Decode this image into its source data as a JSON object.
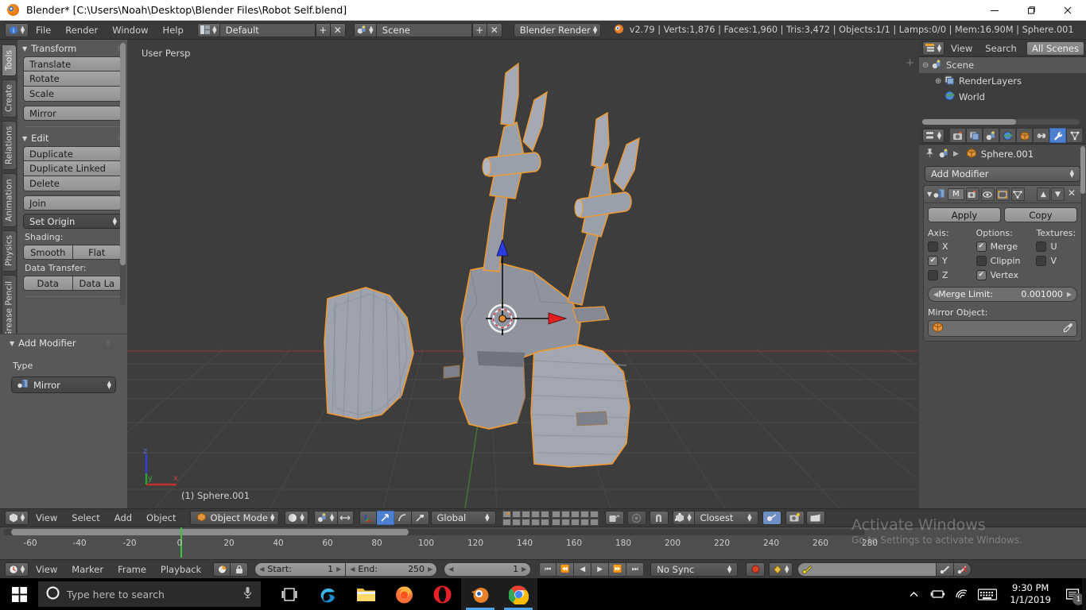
{
  "window": {
    "title": "Blender* [C:\\Users\\Noah\\Desktop\\Blender Files\\Robot Self.blend]",
    "minimize": "—",
    "maximize": "❐",
    "close": "✕"
  },
  "header": {
    "menus": [
      "File",
      "Render",
      "Window",
      "Help"
    ],
    "screen_layout": "Default",
    "scene": "Scene",
    "render_engine": "Blender Render",
    "stats": "v2.79 | Verts:1,876 | Faces:1,960 | Tris:3,472 | Objects:1/1 | Lamps:0/0 | Mem:16.90M | Sphere.001",
    "add_label": "+",
    "remove_label": "✕"
  },
  "toolshelf": {
    "tabs": [
      "Tools",
      "Create",
      "Relations",
      "Animation",
      "Physics",
      "Grease Pencil"
    ],
    "active_tab": "Tools",
    "transform": {
      "title": "Transform",
      "buttons": [
        "Translate",
        "Rotate",
        "Scale"
      ],
      "mirror": "Mirror"
    },
    "edit": {
      "title": "Edit",
      "buttons": [
        "Duplicate",
        "Duplicate Linked",
        "Delete"
      ],
      "join": "Join",
      "set_origin": "Set Origin",
      "shading_label": "Shading:",
      "shading_buttons": [
        "Smooth",
        "Flat"
      ],
      "data_transfer_label": "Data Transfer:",
      "data_buttons": [
        "Data",
        "Data La"
      ]
    },
    "add_modifier_panel": {
      "title": "Add Modifier",
      "type_label": "Type",
      "type_value": "Mirror"
    }
  },
  "viewport": {
    "view_label": "User Persp",
    "object_label": "(1) Sphere.001",
    "axis_x": "x",
    "axis_y": "y",
    "axis_z": "z"
  },
  "outliner": {
    "menus": [
      "View",
      "Search"
    ],
    "filter": "All Scenes",
    "rows": [
      {
        "label": "Scene",
        "icon": "scene-icon",
        "indent": 0,
        "selected": true
      },
      {
        "label": "RenderLayers",
        "icon": "renderlayers-icon",
        "indent": 1,
        "selected": false
      },
      {
        "label": "World",
        "icon": "world-icon",
        "indent": 1,
        "selected": false
      }
    ]
  },
  "properties": {
    "tabs": [
      "render-icon",
      "renderlayers-icon",
      "scene-icon",
      "world-icon",
      "object-icon",
      "constraints-icon",
      "modifiers-icon",
      "data-icon"
    ],
    "active_tab_index": 6,
    "breadcrumb_object": "Sphere.001",
    "add_modifier": "Add Modifier",
    "modifier": {
      "name_short": "M",
      "apply": "Apply",
      "copy": "Copy",
      "axis_title": "Axis:",
      "options_title": "Options:",
      "textures_title": "Textures:",
      "axis": [
        {
          "label": "X",
          "checked": false
        },
        {
          "label": "Y",
          "checked": true
        },
        {
          "label": "Z",
          "checked": false
        }
      ],
      "options": [
        {
          "label": "Merge",
          "checked": true
        },
        {
          "label": "Clippin",
          "checked": false
        },
        {
          "label": "Vertex",
          "checked": true
        }
      ],
      "textures": [
        {
          "label": "U",
          "checked": false
        },
        {
          "label": "V",
          "checked": false
        }
      ],
      "merge_limit_label": "Merge Limit:",
      "merge_limit_value": "0.001000",
      "mirror_object_label": "Mirror Object:",
      "mirror_object_value": ""
    }
  },
  "viewport_header": {
    "menus": [
      "View",
      "Select",
      "Add",
      "Object"
    ],
    "mode": "Object Mode",
    "transform_orientation": "Global",
    "snap_mode": "Closest"
  },
  "timeline": {
    "menus": [
      "View",
      "Marker",
      "Frame",
      "Playback"
    ],
    "start_label": "Start:",
    "start_value": "1",
    "end_label": "End:",
    "end_value": "250",
    "current_frame": "1",
    "sync_mode": "No Sync",
    "ticks": [
      "-60",
      "-40",
      "-20",
      "0",
      "20",
      "40",
      "60",
      "80",
      "100",
      "120",
      "140",
      "160",
      "180",
      "200",
      "220",
      "240",
      "260",
      "280"
    ]
  },
  "watermark": {
    "line1": "Activate Windows",
    "line2": "Go to Settings to activate Windows."
  },
  "taskbar": {
    "search_placeholder": "Type here to search",
    "apps": [
      {
        "name": "task-view",
        "active": false
      },
      {
        "name": "edge",
        "active": false
      },
      {
        "name": "file-explorer",
        "active": false
      },
      {
        "name": "firefox",
        "active": false
      },
      {
        "name": "opera",
        "active": false
      },
      {
        "name": "blender",
        "active": true
      },
      {
        "name": "chrome",
        "active": true
      }
    ],
    "time": "9:30 PM",
    "date": "1/1/2019",
    "notification_count": "1"
  }
}
